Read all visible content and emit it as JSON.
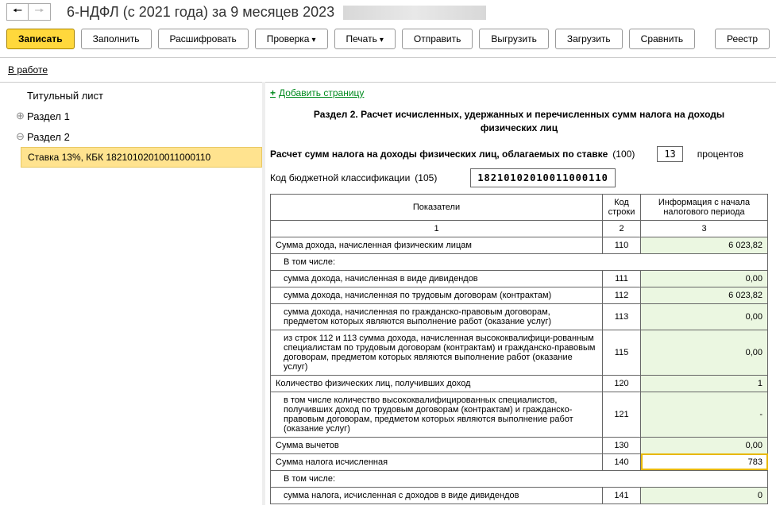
{
  "header": {
    "title": "6-НДФЛ (с 2021 года) за 9 месяцев 2023"
  },
  "toolbar": {
    "write": "Записать",
    "fill": "Заполнить",
    "decipher": "Расшифровать",
    "check": "Проверка",
    "print": "Печать",
    "send": "Отправить",
    "export": "Выгрузить",
    "import": "Загрузить",
    "compare": "Сравнить",
    "register": "Реестр"
  },
  "status": {
    "in_work": "В работе"
  },
  "sidebar": {
    "items": [
      {
        "label": "Титульный лист",
        "expander": ""
      },
      {
        "label": "Раздел 1",
        "expander": "⊕"
      },
      {
        "label": "Раздел 2",
        "expander": "⊖"
      }
    ],
    "child": "Ставка 13%, КБК 18210102010011000110"
  },
  "main": {
    "add_page": "Добавить страницу",
    "section_title": "Раздел 2. Расчет исчисленных, удержанных и перечисленных сумм налога на доходы физических лиц",
    "rate_line_a": "Расчет сумм налога на доходы физических лиц, облагаемых по ставке",
    "rate_code": "(100)",
    "rate_value": "13",
    "rate_suffix": "процентов",
    "kbk_label": "Код бюджетной классификации",
    "kbk_code": "(105)",
    "kbk_value": "18210102010011000110",
    "table": {
      "head": {
        "c1": "Показатели",
        "c2": "Код строки",
        "c3": "Информация с начала налогового периода"
      },
      "subhead": {
        "c1": "1",
        "c2": "2",
        "c3": "3"
      },
      "rows": [
        {
          "label": "Сумма дохода, начисленная физическим лицам",
          "code": "110",
          "value": "6 023,82",
          "hl": false,
          "indent": false
        },
        {
          "label": "В том числе:",
          "code": "",
          "value": "",
          "hl": false,
          "indent": true,
          "novalue": true
        },
        {
          "label": "сумма дохода, начисленная в виде дивидендов",
          "code": "111",
          "value": "0,00",
          "hl": false,
          "indent": true
        },
        {
          "label": "сумма дохода, начисленная по трудовым договорам (контрактам)",
          "code": "112",
          "value": "6 023,82",
          "hl": false,
          "indent": true
        },
        {
          "label": "сумма дохода, начисленная по гражданско-правовым договорам, предметом которых являются выполнение работ (оказание услуг)",
          "code": "113",
          "value": "0,00",
          "hl": false,
          "indent": true
        },
        {
          "label": "из строк 112 и 113 сумма дохода, начисленная высококвалифици-рованным специалистам по трудовым договорам (контрактам) и гражданско-правовым договорам, предметом которых являются выполнение работ (оказание услуг)",
          "code": "115",
          "value": "0,00",
          "hl": false,
          "indent": true
        },
        {
          "label": "Количество физических лиц, получивших доход",
          "code": "120",
          "value": "1",
          "hl": false,
          "indent": false
        },
        {
          "label": "в том числе количество высококвалифицированных специалистов, получивших доход по трудовым договорам (контрактам) и гражданско-правовым договорам, предметом которых являются выполнение работ (оказание услуг)",
          "code": "121",
          "value": "-",
          "hl": false,
          "indent": true
        },
        {
          "label": "Сумма вычетов",
          "code": "130",
          "value": "0,00",
          "hl": false,
          "indent": false
        },
        {
          "label": "Сумма налога исчисленная",
          "code": "140",
          "value": "783",
          "hl": true,
          "indent": false
        },
        {
          "label": "В том числе:",
          "code": "",
          "value": "",
          "hl": false,
          "indent": true,
          "novalue": true
        },
        {
          "label": "сумма налога, исчисленная с доходов в виде дивидендов",
          "code": "141",
          "value": "0",
          "hl": false,
          "indent": true
        }
      ]
    }
  }
}
